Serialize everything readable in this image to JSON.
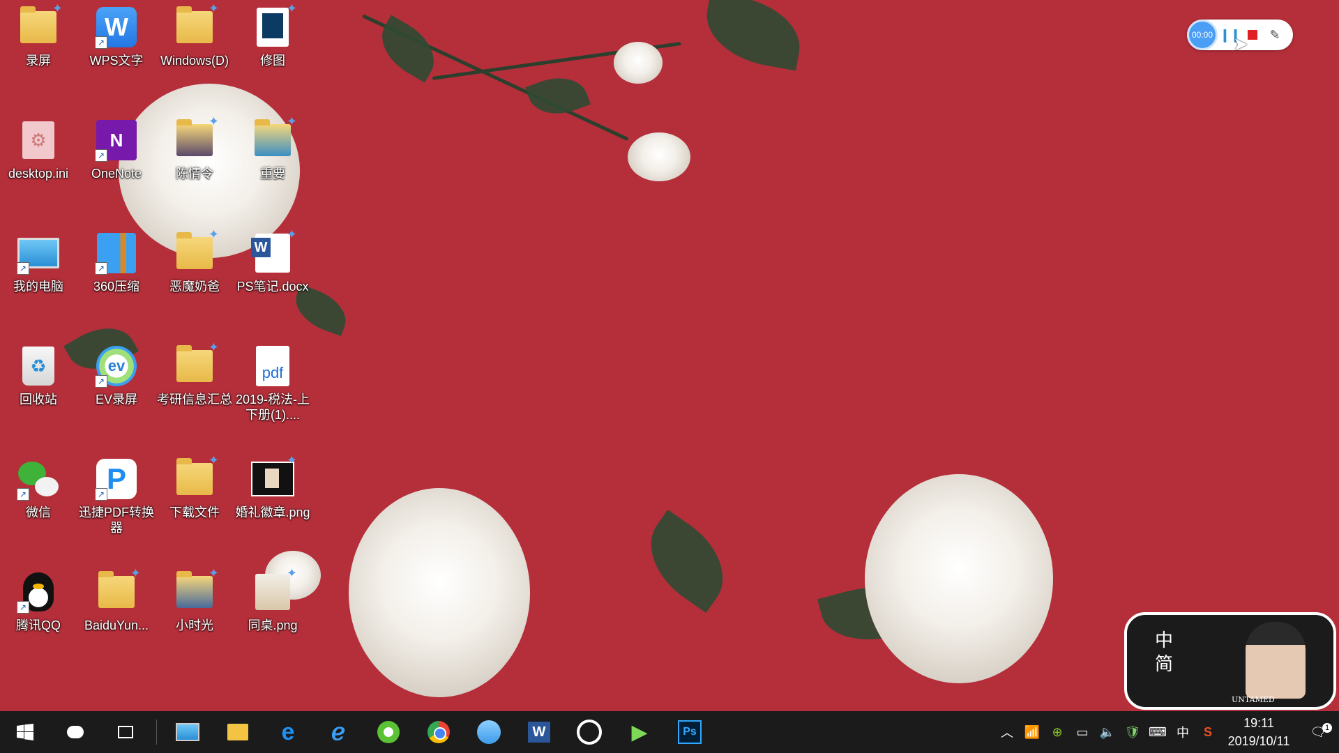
{
  "desktop": {
    "icons": [
      {
        "label": "录屏"
      },
      {
        "label": "WPS文字"
      },
      {
        "label": "Windows(D)"
      },
      {
        "label": "修图"
      },
      {
        "label": "desktop.ini"
      },
      {
        "label": "OneNote"
      },
      {
        "label": "陈情令"
      },
      {
        "label": "重要"
      },
      {
        "label": "我的电脑"
      },
      {
        "label": "360压缩"
      },
      {
        "label": "恶魔奶爸"
      },
      {
        "label": "PS笔记.docx"
      },
      {
        "label": "回收站"
      },
      {
        "label": "EV录屏"
      },
      {
        "label": "考研信息汇总"
      },
      {
        "label": "2019-税法-上下册(1)...."
      },
      {
        "label": "微信"
      },
      {
        "label": "迅捷PDF转换器"
      },
      {
        "label": "下载文件"
      },
      {
        "label": "婚礼徽章.png"
      },
      {
        "label": "腾讯QQ"
      },
      {
        "label": "BaiduYun..."
      },
      {
        "label": "小时光"
      },
      {
        "label": "同桌.png"
      }
    ]
  },
  "recorder": {
    "timer": "00:00"
  },
  "widget": {
    "chars": "中\n简",
    "caption": "UNTAMED"
  },
  "taskbar": {
    "clock": {
      "time": "19:11",
      "date": "2019/10/11"
    },
    "ime": "中",
    "notifications": "1"
  },
  "colors": {
    "wallpaper": "#b52f3a",
    "taskbar": "#1b1b1b",
    "accent": "#4a9ef5"
  }
}
